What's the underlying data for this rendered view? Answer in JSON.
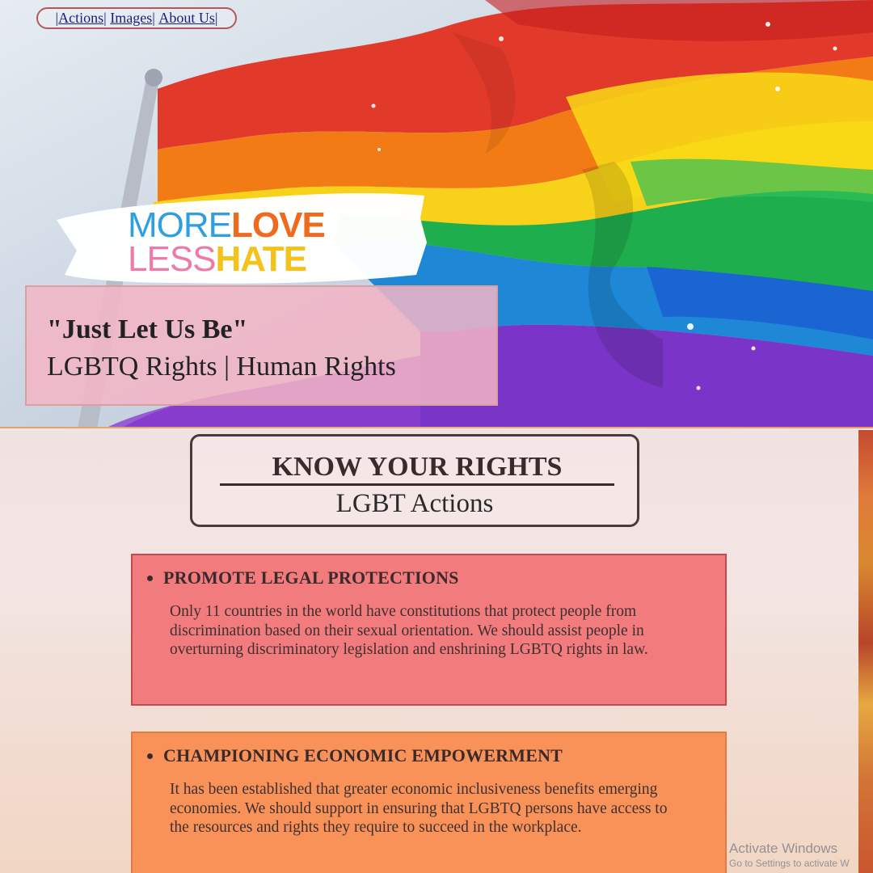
{
  "nav": {
    "items": [
      {
        "label": "Actions"
      },
      {
        "label": "Images"
      },
      {
        "label": "About Us"
      }
    ],
    "separator": "|"
  },
  "logo": {
    "more": "MORE",
    "love": "LOVE",
    "less": "LESS",
    "hate": "HATE"
  },
  "hero": {
    "quote": "\"Just Let Us Be\"",
    "subtitle": "LGBTQ Rights | Human Rights"
  },
  "rights": {
    "heading": "KNOW YOUR RIGHTS",
    "subheading": "LGBT Actions"
  },
  "cards": [
    {
      "title": "PROMOTE LEGAL PROTECTIONS",
      "body": "Only 11 countries in the world have constitutions that protect people from discrimination based on their sexual orientation. We should assist people in overturning discriminatory legislation and enshrining LGBTQ rights in law.",
      "color": "#f17b7d"
    },
    {
      "title": "CHAMPIONING ECONOMIC EMPOWERMENT",
      "body": "It has been established that greater economic inclusiveness benefits emerging economies. We should support in ensuring that LGBTQ persons have access to the resources and rights they require to succeed in the workplace.",
      "color": "#f89258"
    }
  ],
  "watermark": {
    "line1": "Activate Windows",
    "line2": "Go to Settings to activate W"
  },
  "colors": {
    "nav_border": "#b5585a",
    "title_box": "#f3b5c6",
    "rights_border": "#4a3a3e"
  }
}
